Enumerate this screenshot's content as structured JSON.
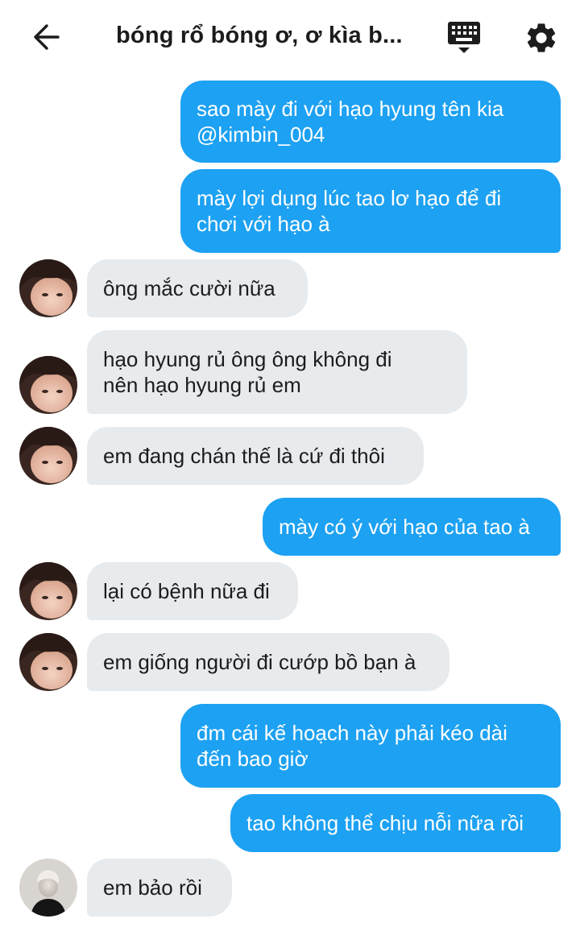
{
  "header": {
    "title": "bóng rổ bóng ơ, ơ kìa b...",
    "back_icon": "arrow-left-icon",
    "keyboard_icon": "keyboard-icon",
    "settings_icon": "gear-icon"
  },
  "colors": {
    "outgoing_bubble": "#1da1f2",
    "incoming_bubble": "#e7ebee",
    "text_dark": "#1c1c1c",
    "text_light": "#ffffff"
  },
  "messages": [
    {
      "direction": "out",
      "lines": [
        "sao mày đi với hạo hyung tên kia",
        "@kimbin_004"
      ]
    },
    {
      "direction": "out",
      "lines": [
        "mày lợi dụng lúc tao lơ hạo để đi",
        "chơi với hạo à"
      ]
    },
    {
      "direction": "in",
      "lines": [
        "ông mắc cười nữa"
      ]
    },
    {
      "direction": "in",
      "lines": [
        "hạo hyung rủ ông ông không đi",
        "nên hạo hyung rủ em"
      ]
    },
    {
      "direction": "in",
      "lines": [
        "em đang chán thế là cứ đi thôi"
      ]
    },
    {
      "direction": "out",
      "lines": [
        "mày có ý với hạo của tao à"
      ]
    },
    {
      "direction": "in",
      "lines": [
        "lại có bệnh nữa đi"
      ]
    },
    {
      "direction": "in",
      "lines": [
        "em giống người đi cướp bồ bạn à"
      ]
    },
    {
      "direction": "out",
      "lines": [
        "đm cái kế hoạch này phải kéo dài",
        "đến bao giờ"
      ]
    },
    {
      "direction": "out",
      "lines": [
        "tao không thể chịu nỗi nữa rồi"
      ]
    },
    {
      "direction": "in",
      "lines": [
        "em bảo rồi"
      ]
    }
  ]
}
